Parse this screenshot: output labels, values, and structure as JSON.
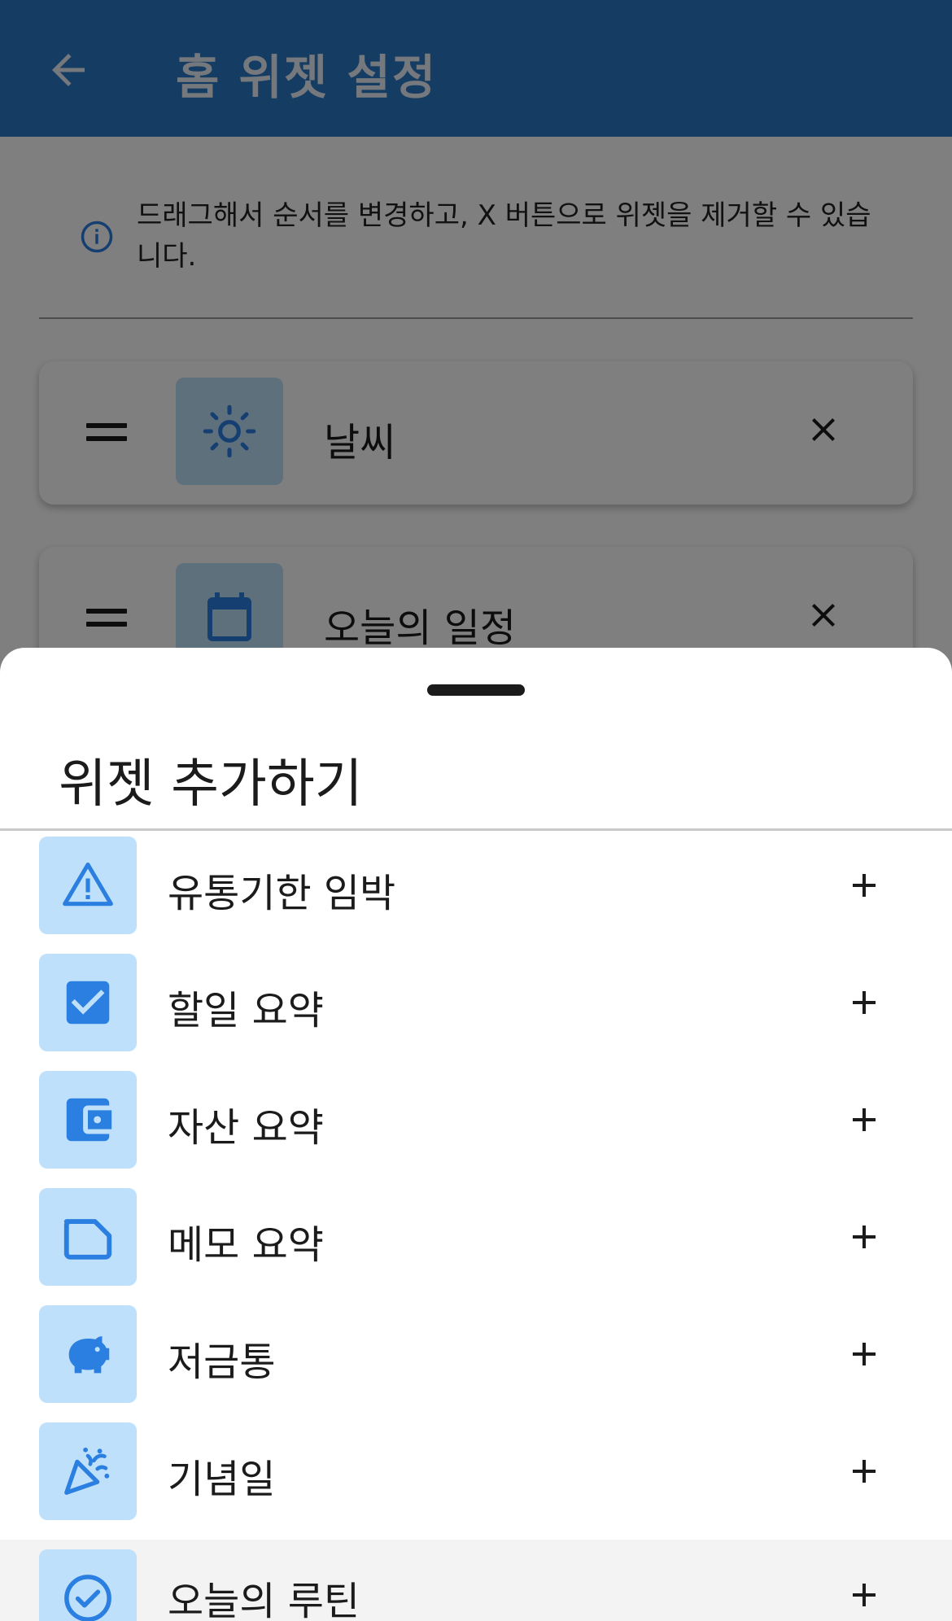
{
  "appbar": {
    "title": "홈 위젯 설정",
    "back_icon": "arrow-back-icon",
    "color": "#2b79c5"
  },
  "info": {
    "icon": "info-icon",
    "text": "드래그해서 순서를 변경하고, X 버튼으로 위젯을 제거할 수 있습니다."
  },
  "active_widgets": [
    {
      "label": "날씨",
      "icon": "sun-icon"
    },
    {
      "label": "오늘의 일정",
      "icon": "calendar-icon"
    }
  ],
  "sheet": {
    "title": "위젯 추가하기",
    "items": [
      {
        "label": "유통기한 임박",
        "icon": "warning-icon"
      },
      {
        "label": "할일 요약",
        "icon": "checkbox-icon"
      },
      {
        "label": "자산 요약",
        "icon": "wallet-icon"
      },
      {
        "label": "메모 요약",
        "icon": "note-icon"
      },
      {
        "label": "저금통",
        "icon": "piggy-bank-icon"
      },
      {
        "label": "기념일",
        "icon": "celebration-icon"
      },
      {
        "label": "오늘의 루틴",
        "icon": "check-circle-icon"
      }
    ]
  },
  "colors": {
    "accent": "#2b7fe0",
    "tile": "#bfe0fb",
    "scrim": "rgba(0,0,0,0.5)"
  }
}
